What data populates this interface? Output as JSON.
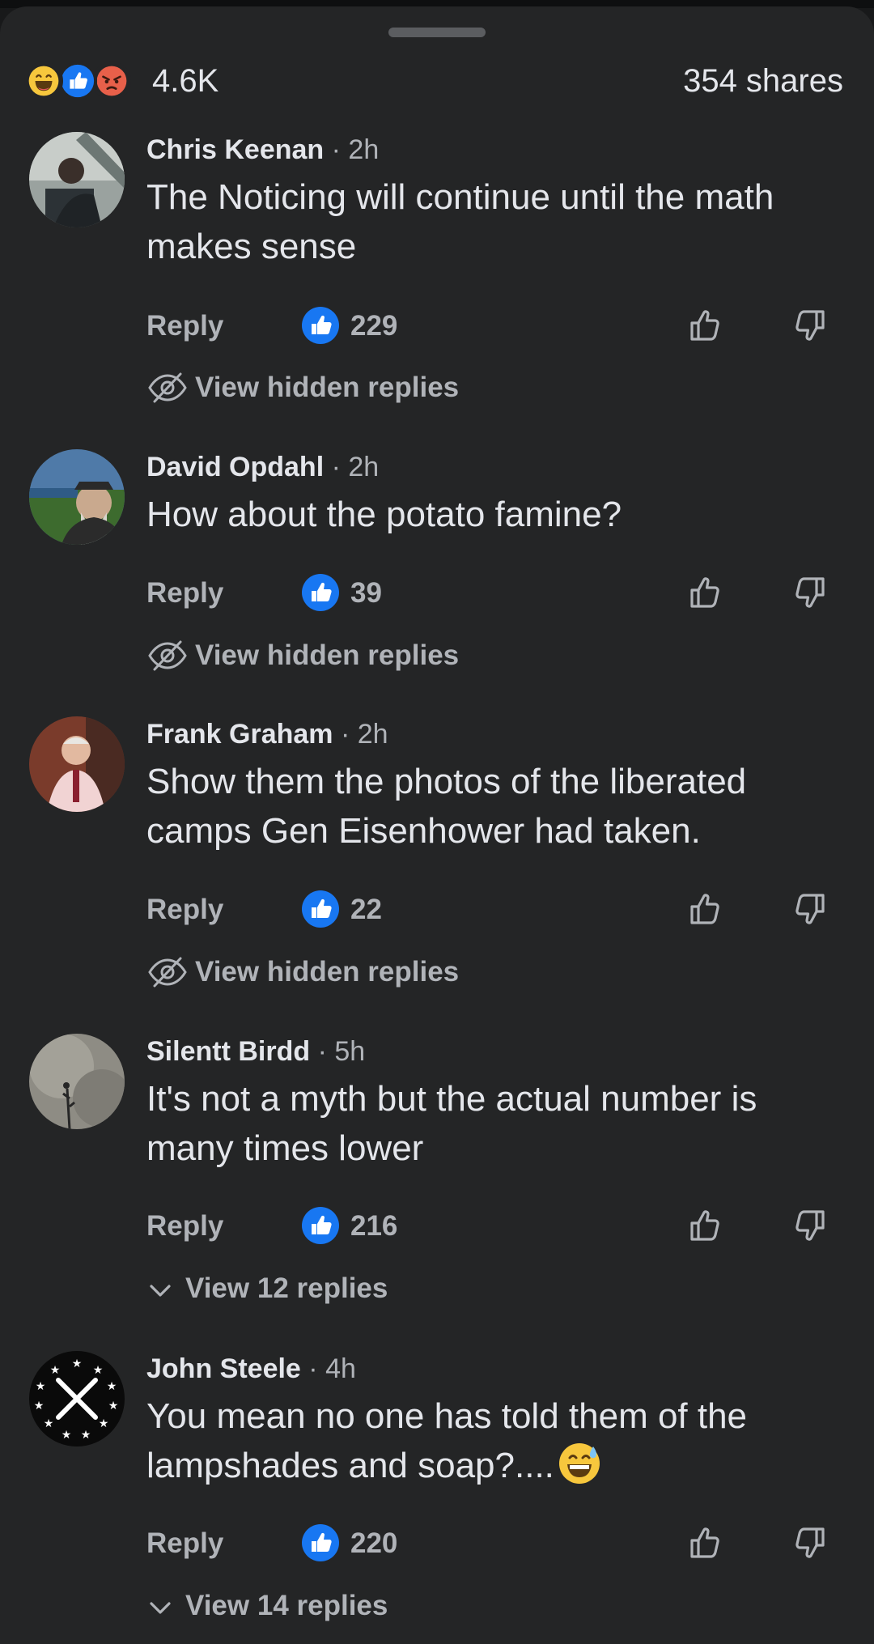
{
  "reactions": {
    "icons": [
      "haha-icon",
      "like-icon",
      "angry-icon"
    ],
    "count": "4.6K",
    "shares": "354 shares"
  },
  "comments": [
    {
      "name": "Chris Keenan",
      "time": "· 2h",
      "text": "The Noticing will continue until the math makes sense",
      "reply": "Reply",
      "likes": "229",
      "footer": "View hidden replies"
    },
    {
      "name": "David Opdahl",
      "time": "· 2h",
      "text": "How about the potato famine?",
      "reply": "Reply",
      "likes": "39",
      "footer": "View hidden replies"
    },
    {
      "name": "Frank Graham",
      "time": "· 2h",
      "text": "Show them the photos  of the liberated camps Gen Eisenhower had taken.",
      "reply": "Reply",
      "likes": "22",
      "footer": "View hidden replies"
    },
    {
      "name": "Silentt Birdd",
      "time": "· 5h",
      "text": "It's not a myth but the actual number is many times lower",
      "reply": "Reply",
      "likes": "216",
      "footer": "View 12 replies"
    },
    {
      "name": "John Steele",
      "time": "· 4h",
      "text": "You mean no one has told them of the lampshades and soap?....",
      "text_emoji": "sweat-smile-emoji",
      "reply": "Reply",
      "likes": "220",
      "footer": "View 14 replies"
    }
  ],
  "colors": {
    "background": "#242526",
    "text": "#e4e6eb",
    "secondary": "#b0b3b8",
    "like_blue": "#1877f2"
  }
}
